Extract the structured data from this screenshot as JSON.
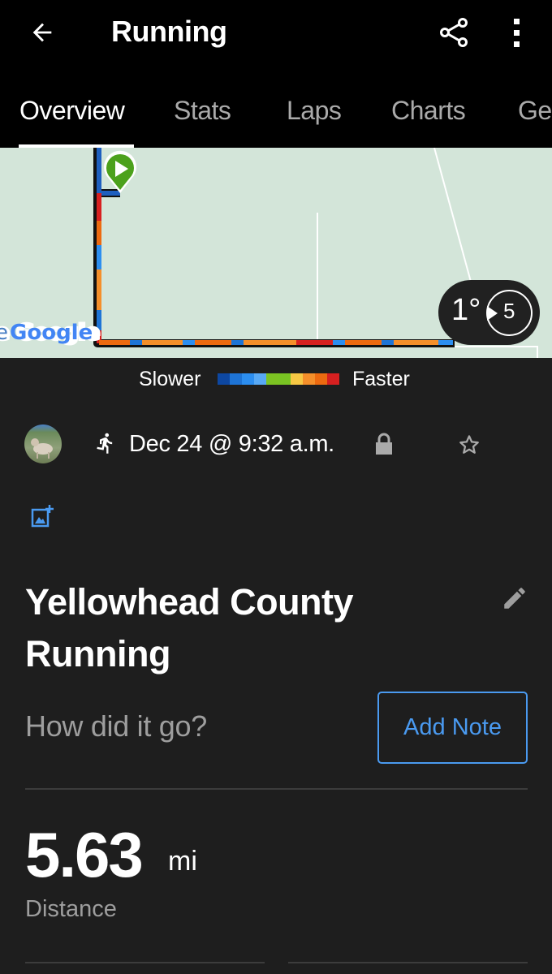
{
  "appbar": {
    "title": "Running",
    "icons": {
      "back": "arrow-left-icon",
      "share": "share-icon",
      "more": "more-vert-icon"
    }
  },
  "tabs": [
    {
      "label": "Overview",
      "active": true
    },
    {
      "label": "Stats",
      "active": false
    },
    {
      "label": "Laps",
      "active": false
    },
    {
      "label": "Charts",
      "active": false
    },
    {
      "label": "Ge",
      "active": false
    }
  ],
  "map": {
    "attribution": "Google",
    "start_marker": "play-marker-icon",
    "badge": {
      "value": "1°",
      "count": "5"
    }
  },
  "legend": {
    "slower": "Slower",
    "faster": "Faster",
    "colors": [
      "#0d47a1",
      "#1e74d6",
      "#2c8ef0",
      "#58a9f5",
      "#7cc322",
      "#79c423",
      "#f7c844",
      "#f58f2a",
      "#ed6a10",
      "#d72020"
    ]
  },
  "activity": {
    "date": "Dec 24 @ 9:32 a.m.",
    "type_icon": "running-icon",
    "privacy_icon": "lock-icon",
    "favorite_icon": "star-outline-icon",
    "add_photo_icon": "add-photo-icon",
    "title": "Yellowhead County Running",
    "note_prompt": "How did it go?",
    "add_note_label": "Add Note"
  },
  "stats": {
    "distance": {
      "value": "5.63",
      "unit": "mi",
      "label": "Distance"
    }
  },
  "colors": {
    "accent": "#4a9af0",
    "background": "#1e1e1e",
    "appbar": "#000000",
    "map_bg": "#d3e5d9"
  }
}
